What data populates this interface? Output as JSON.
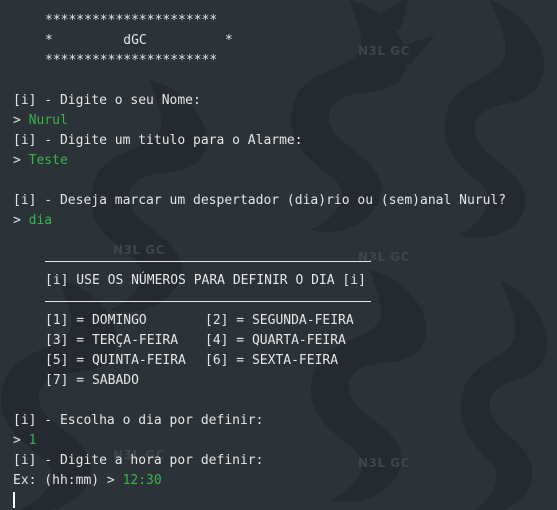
{
  "watermark": {
    "text": "N3L GC"
  },
  "banner": {
    "top": "**********************",
    "middle": "*         dGC          *",
    "bottom": "**********************"
  },
  "prompts": {
    "name_prompt": "[i] - Digite o seu Nome:",
    "name_marker": "> ",
    "name_value": "Nurul",
    "title_prompt": "[i] - Digite um titulo para o Alarme:",
    "title_marker": "> ",
    "title_value": "Teste",
    "mode_prompt": "[i] - Deseja marcar um despertador (dia)rio ou (sem)anal Nurul?",
    "mode_marker": "> ",
    "mode_value": "dia"
  },
  "day_menu": {
    "header": "[i] USE OS NÚMEROS PARA DEFINIR O DIA [i]",
    "rows": [
      {
        "left": "[1] = DOMINGO",
        "right": "[2] = SEGUNDA-FEIRA"
      },
      {
        "left": "[3] = TERÇA-FEIRA",
        "right": "[4] = QUARTA-FEIRA"
      },
      {
        "left": "[5] = QUINTA-FEIRA",
        "right": "[6] = SEXTA-FEIRA"
      },
      {
        "left": "[7] = SABADO",
        "right": ""
      }
    ]
  },
  "day_choice": {
    "prompt": "[i] - Escolha o dia por definir:",
    "marker": "> ",
    "value": "1"
  },
  "hour_choice": {
    "prompt": "[i] - Digite a hora por definir:",
    "example": "Ex: (hh:mm) > ",
    "value": "12:30"
  }
}
